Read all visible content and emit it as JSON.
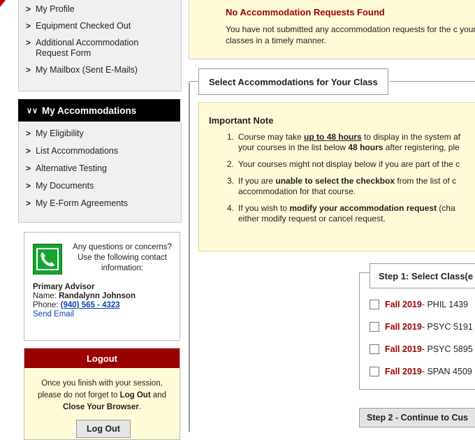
{
  "sidebar": {
    "top_items": [
      {
        "label": "My Profile"
      },
      {
        "label": "Equipment Checked Out"
      },
      {
        "label": "Additional Accommodation Request Form"
      },
      {
        "label": "My Mailbox (Sent E-Mails)"
      }
    ],
    "accommodations_header": "My Accommodations",
    "accommodation_items": [
      {
        "label": "My Eligibility"
      },
      {
        "label": "List Accommodations"
      },
      {
        "label": "Alternative Testing"
      },
      {
        "label": "My Documents"
      },
      {
        "label": "My E-Form Agreements"
      }
    ],
    "contact": {
      "intro": "Any questions or concerns? Use the following contact information:",
      "role": "Primary Advisor",
      "name_label": "Name: ",
      "name": "Randalynn Johnson",
      "phone_label": "Phone: ",
      "phone": "(940) 565 - 4323",
      "email_link": "Send Email"
    },
    "logout": {
      "header": "Logout",
      "text_1": "Once you finish with your session, please do not forget to ",
      "text_bold_1": "Log Out",
      "text_2": " and ",
      "text_bold_2": "Close Your Browser",
      "text_3": ".",
      "button": "Log Out"
    }
  },
  "alert": {
    "title": "No Accommodation Requests Found",
    "text": "You have not submitted any accommodation requests for the c your classes in a timely manner."
  },
  "section_legend": "Select Accommodations for Your Class",
  "important_note": {
    "title": "Important Note",
    "items": [
      {
        "num": "1.",
        "line1_a": "Course may take ",
        "line1_b": "up to 48 hours",
        "line1_c": " to display in the system af",
        "line2_a": "your courses in the list below ",
        "line2_b": "48 hours",
        "line2_c": " after registering, ple"
      },
      {
        "num": "2.",
        "line1_a": "Your courses might not display below if you are part of the c"
      },
      {
        "num": "3.",
        "line1_a": "If you are ",
        "line1_b": "unable to select the checkbox",
        "line1_c": " from the list of c",
        "line2_a": "accommodation for that course."
      },
      {
        "num": "4.",
        "line1_a": "If you wish to ",
        "line1_b": "modify your accommodation request",
        "line1_c": " (cha",
        "line2_a": "either modify request or cancel request."
      }
    ]
  },
  "step1": {
    "legend": "Step 1: Select Class(e",
    "classes": [
      {
        "term": "Fall 2019",
        "course": " - PHIL 1439"
      },
      {
        "term": "Fall 2019",
        "course": " - PSYC 5191"
      },
      {
        "term": "Fall 2019",
        "course": " - PSYC 5895"
      },
      {
        "term": "Fall 2019",
        "course": " - SPAN 4509"
      }
    ]
  },
  "step2_button": "Step 2 - Continue to Cus"
}
